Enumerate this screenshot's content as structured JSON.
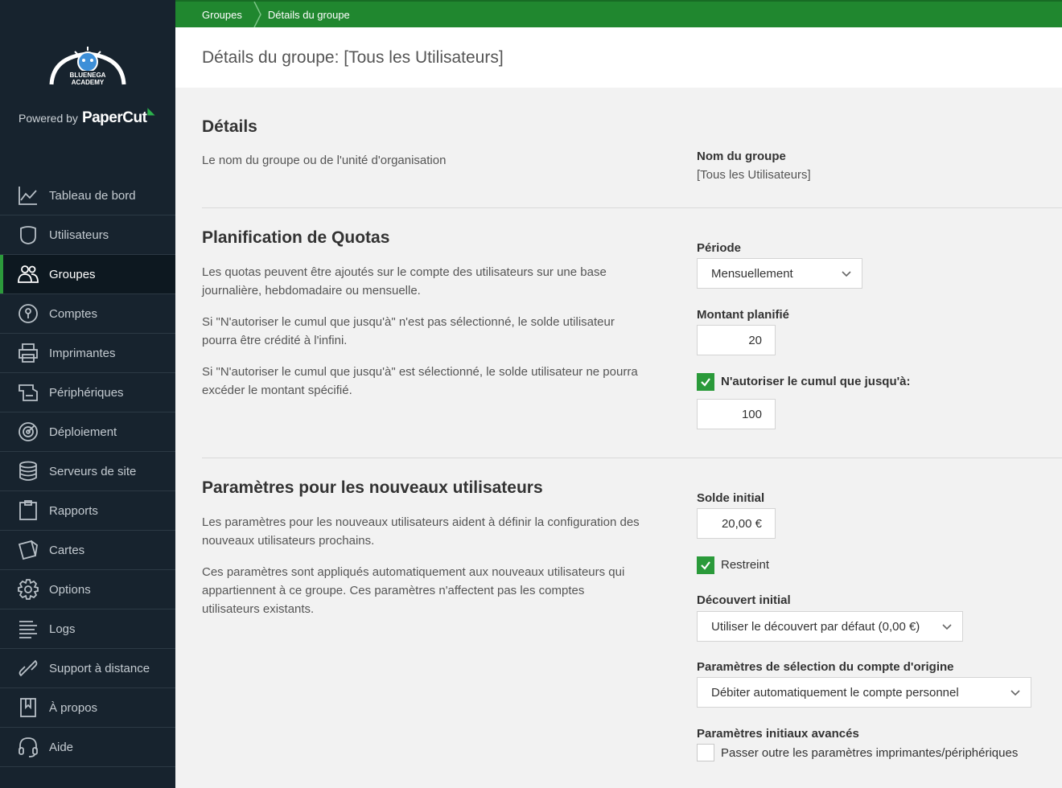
{
  "brand": {
    "powered_by": "Powered by",
    "product": "PaperCut",
    "logo_top": "BLUENEGA",
    "logo_bottom": "ACADEMY"
  },
  "sidebar": {
    "items": [
      {
        "label": "Tableau de bord",
        "icon": "chart-line-icon"
      },
      {
        "label": "Utilisateurs",
        "icon": "user-icon"
      },
      {
        "label": "Groupes",
        "icon": "group-icon"
      },
      {
        "label": "Comptes",
        "icon": "account-icon"
      },
      {
        "label": "Imprimantes",
        "icon": "printer-icon"
      },
      {
        "label": "Périphériques",
        "icon": "device-icon"
      },
      {
        "label": "Déploiement",
        "icon": "deployment-icon"
      },
      {
        "label": "Serveurs de site",
        "icon": "database-icon"
      },
      {
        "label": "Rapports",
        "icon": "clipboard-icon"
      },
      {
        "label": "Cartes",
        "icon": "cards-icon"
      },
      {
        "label": "Options",
        "icon": "gear-icon"
      },
      {
        "label": "Logs",
        "icon": "logs-icon"
      },
      {
        "label": "Support à distance",
        "icon": "link-icon"
      },
      {
        "label": "À propos",
        "icon": "book-icon"
      },
      {
        "label": "Aide",
        "icon": "headset-icon"
      }
    ],
    "active_index": 2
  },
  "breadcrumb": {
    "item1": "Groupes",
    "item2": "Détails du groupe"
  },
  "page": {
    "title": "Détails du groupe: [Tous les Utilisateurs]"
  },
  "details": {
    "title": "Détails",
    "description": "Le nom du groupe ou de l'unité d'organisation",
    "group_name_label": "Nom du groupe",
    "group_name_value": "[Tous les Utilisateurs]"
  },
  "quota": {
    "title": "Planification de Quotas",
    "desc1": "Les quotas peuvent être ajoutés sur le compte des utilisateurs sur une base journalière, hebdomadaire ou mensuelle.",
    "desc2": "Si \"N'autoriser le cumul que jusqu'à\" n'est pas sélectionné, le solde utilisateur pourra être crédité à l'infini.",
    "desc3": "Si \"N'autoriser le cumul que jusqu'à\" est sélectionné, le solde utilisateur ne pourra excéder le montant spécifié.",
    "period_label": "Période",
    "period_value": "Mensuellement",
    "amount_label": "Montant planifié",
    "amount_value": "20",
    "cumul_label": "N'autoriser le cumul que jusqu'à:",
    "cumul_checked": true,
    "cumul_value": "100"
  },
  "new_users": {
    "title": "Paramètres pour les nouveaux utilisateurs",
    "desc1": "Les paramètres pour les nouveaux utilisateurs aident à définir la configuration des nouveaux utilisateurs prochains.",
    "desc2": "Ces paramètres sont appliqués automatiquement aux nouveaux utilisateurs qui appartiennent à ce groupe. Ces paramètres n'affectent pas les comptes utilisateurs existants.",
    "initial_balance_label": "Solde initial",
    "initial_balance_value": "20,00 €",
    "restricted_label": "Restreint",
    "restricted_checked": true,
    "overdraft_label": "Découvert initial",
    "overdraft_value": "Utiliser le découvert par défaut (0,00 €)",
    "account_selection_label": "Paramètres de sélection du compte d'origine",
    "account_selection_value": "Débiter automatiquement le compte personnel",
    "advanced_label": "Paramètres initiaux avancés",
    "override_label": "Passer outre les paramètres imprimantes/périphériques",
    "override_checked": false
  },
  "colors": {
    "sidebar_bg": "#17232e",
    "topbar_green": "#20872f",
    "checkbox_green": "#2a9a3a"
  }
}
